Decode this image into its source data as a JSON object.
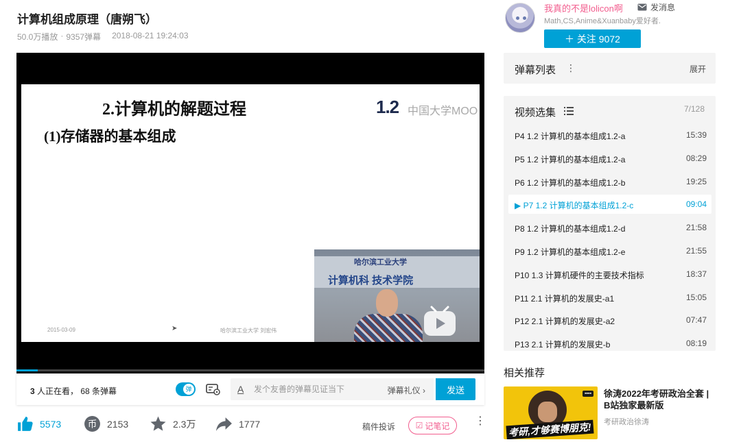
{
  "video": {
    "title": "计算机组成原理（唐朔飞）",
    "plays": "50.0万播放",
    "separator": "·",
    "danmaku_count": "9357弹幕",
    "pubdate": "2018-08-21 19:24:03"
  },
  "slide": {
    "title": "2.计算机的解题过程",
    "subtitle": "(1)存储器的基本组成",
    "number": "1.2",
    "mooc_logo": "中国大学MOO",
    "date": "2015-03-09",
    "footer": "哈尔滨工业大学  刘宏伟",
    "pip_line1": "哈尔滨工业大学",
    "pip_line2": "计算机科      技术学院"
  },
  "player": {
    "progress": 0.045
  },
  "danmaku_bar": {
    "viewers_num": "3",
    "viewers_text": " 人正在看， 68 条弹幕",
    "toggle_label": "弹",
    "input_placeholder": "发个友善的弹幕见证当下",
    "etiquette": "弹幕礼仪 ›",
    "send": "发送"
  },
  "actions": {
    "like": "5573",
    "coin": "2153",
    "coin_glyph": "币",
    "favorite": "2.3万",
    "share": "1777",
    "report": "稿件投诉",
    "note": "记笔记",
    "note_glyph": "☑",
    "more": "⋮"
  },
  "uploader": {
    "name": "我真的不是lolicon啊",
    "message": "发消息",
    "desc": "Math,CS,Anime&Xuanbaby爱好者.",
    "follow": "＋  关注 9072"
  },
  "danmaku_list": {
    "title": "弹幕列表",
    "menu": "⋮",
    "expand": "展开"
  },
  "playlist": {
    "title": "视频选集",
    "count": "7/128",
    "items": [
      {
        "label": "P4  1.2 计算机的基本组成1.2-a",
        "duration": "15:39",
        "active": false
      },
      {
        "label": "P5  1.2 计算机的基本组成1.2-a",
        "duration": "08:29",
        "active": false
      },
      {
        "label": "P6  1.2 计算机的基本组成1.2-b",
        "duration": "19:25",
        "active": false
      },
      {
        "label": "▶ P7  1.2 计算机的基本组成1.2-c",
        "duration": "09:04",
        "active": true
      },
      {
        "label": "P8  1.2 计算机的基本组成1.2-d",
        "duration": "21:58",
        "active": false
      },
      {
        "label": "P9  1.2 计算机的基本组成1.2-e",
        "duration": "21:55",
        "active": false
      },
      {
        "label": "P10  1.3 计算机硬件的主要技术指标",
        "duration": "18:37",
        "active": false
      },
      {
        "label": "P11  2.1 计算机的发展史-a1",
        "duration": "15:05",
        "active": false
      },
      {
        "label": "P12  2.1 计算机的发展史-a2",
        "duration": "07:47",
        "active": false
      },
      {
        "label": "P13  2.1 计算机的发展史-b",
        "duration": "08:19",
        "active": false
      }
    ]
  },
  "related": {
    "header": "相关推荐",
    "title": "徐涛2022年考研政治全套 | B站独家最新版",
    "author": "考研政治徐涛",
    "thumb_caption": "考研,才够赛博朋克!"
  },
  "colors": {
    "accent": "#00a1d6",
    "pink": "#f25d8e"
  }
}
